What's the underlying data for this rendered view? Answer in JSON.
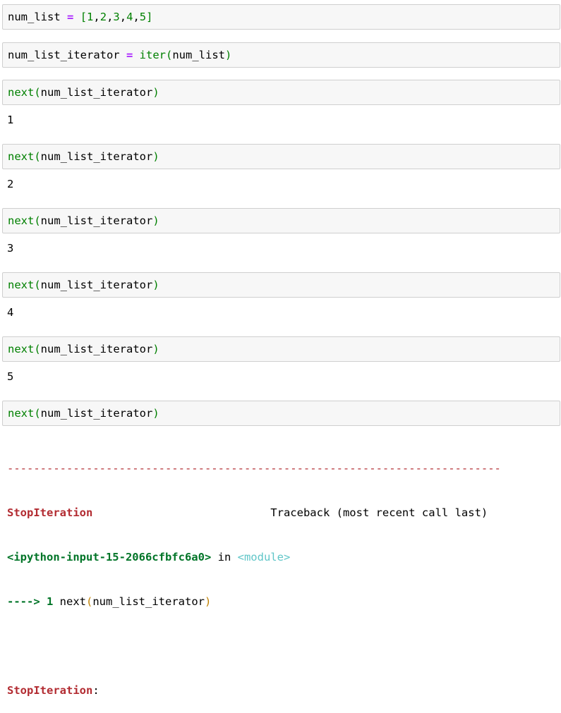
{
  "cells": [
    {
      "input": {
        "var": "num_list",
        "op": "=",
        "list_open": "[",
        "list_items": [
          "1",
          "2",
          "3",
          "4",
          "5"
        ],
        "sep": ",",
        "list_close": "]"
      }
    },
    {
      "input": {
        "var": "num_list_iterator",
        "op": "=",
        "fn": "iter",
        "paren_open": "(",
        "arg": "num_list",
        "paren_close": ")"
      }
    },
    {
      "input": {
        "fn": "next",
        "paren_open": "(",
        "arg": "num_list_iterator",
        "paren_close": ")"
      },
      "output": "1"
    },
    {
      "input": {
        "fn": "next",
        "paren_open": "(",
        "arg": "num_list_iterator",
        "paren_close": ")"
      },
      "output": "2"
    },
    {
      "input": {
        "fn": "next",
        "paren_open": "(",
        "arg": "num_list_iterator",
        "paren_close": ")"
      },
      "output": "3"
    },
    {
      "input": {
        "fn": "next",
        "paren_open": "(",
        "arg": "num_list_iterator",
        "paren_close": ")"
      },
      "output": "4"
    },
    {
      "input": {
        "fn": "next",
        "paren_open": "(",
        "arg": "num_list_iterator",
        "paren_close": ")"
      },
      "output": "5"
    },
    {
      "input": {
        "fn": "next",
        "paren_open": "(",
        "arg": "num_list_iterator",
        "paren_close": ")"
      }
    }
  ],
  "traceback": {
    "separator": "---------------------------------------------------------------------------",
    "error_name": "StopIteration",
    "header_right": "Traceback (most recent call last)",
    "location": "<ipython-input-15-2066cfbfc6a0>",
    "in_word": " in ",
    "module": "<module>",
    "arrow": "----> 1",
    "call_fn": " next",
    "call_paren_open": "(",
    "call_arg": "num_list_iterator",
    "call_paren_close": ")",
    "final_error": "StopIteration",
    "final_colon": ":"
  },
  "colors": {
    "cell_bg": "#f7f7f7",
    "cell_border": "#cfcfcf",
    "operator": "#aa22ff",
    "builtin": "#008000",
    "error_red": "#b22b31",
    "trace_green": "#007427",
    "trace_cyan": "#60c6c8",
    "trace_gold": "#c08000"
  }
}
